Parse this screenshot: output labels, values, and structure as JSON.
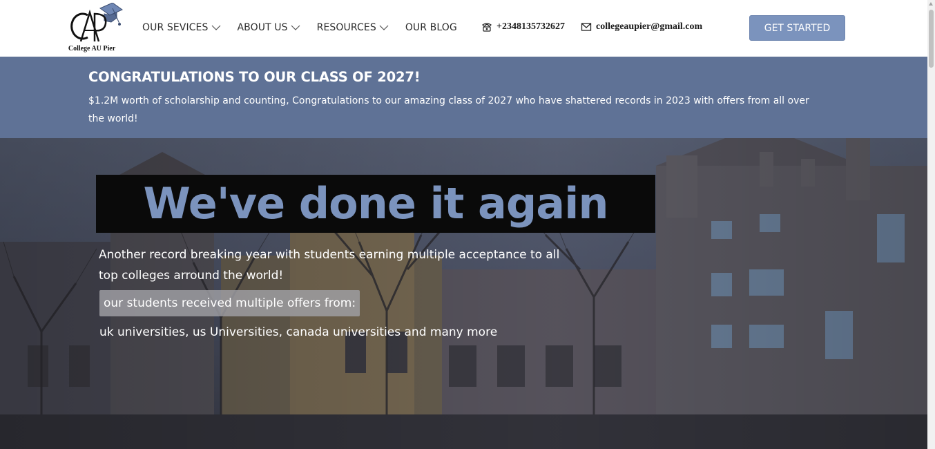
{
  "header": {
    "logo_text": "College AU Pier",
    "nav": [
      {
        "label": "OUR SEVICES",
        "has_dropdown": true
      },
      {
        "label": "ABOUT US",
        "has_dropdown": true
      },
      {
        "label": "RESOURCES",
        "has_dropdown": true
      },
      {
        "label": "OUR BLOG",
        "has_dropdown": false
      }
    ],
    "phone": "+2348135732627",
    "email": "collegeaupier@gmail.com",
    "cta_label": "GET STARTED",
    "icons": {
      "phone": "phone-icon",
      "email": "envelope-icon",
      "dropdown": "chevron-down-icon"
    }
  },
  "announcement": {
    "title": "CONGRATULATIONS TO OUR CLASS OF 2027!",
    "text": "$1.2M worth of scholarship and counting, Congratulations to our amazing class of 2027 who have shattered records in 2023 with offers from all over the world!"
  },
  "hero": {
    "heading": "We've done it again",
    "subheading": "Another record breaking year with students earning multiple acceptance to all top colleges arround the world!",
    "offers_label": "our students received multiple offers from:",
    "universities": "uk universities, us Universities, canada universities and many more"
  },
  "colors": {
    "accent": "#7b93bd",
    "band": "#5f7296",
    "heading_box": "#0a0a0a"
  }
}
